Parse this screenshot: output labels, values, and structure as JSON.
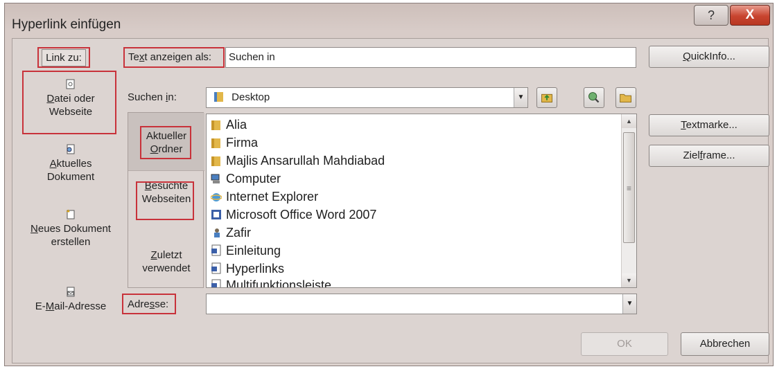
{
  "window": {
    "title": "Hyperlink einfügen",
    "help_symbol": "?",
    "close_symbol": "X"
  },
  "link_to": {
    "label": "Link zu:",
    "items": [
      {
        "label_pre": "",
        "label_u": "D",
        "label_post": "atei oder",
        "line2": "Webseite",
        "icon": "file-icon"
      },
      {
        "label_pre": "",
        "label_u": "A",
        "label_post": "ktuelles",
        "line2": "Dokument",
        "icon": "document-icon"
      },
      {
        "label_pre": "",
        "label_u": "N",
        "label_post": "eues Dokument",
        "line2": "erstellen",
        "icon": "new-document-icon"
      },
      {
        "label_pre": "E-",
        "label_u": "M",
        "label_post": "ail-Adresse",
        "line2": "",
        "icon": "email-icon"
      }
    ]
  },
  "display_text": {
    "label_pre": "Te",
    "label_u": "x",
    "label_post": "t anzeigen als:",
    "value": "Suchen in"
  },
  "quickinfo_button": {
    "label_u": "Q",
    "label_post": "uickInfo..."
  },
  "look_in": {
    "label_pre": "Suchen ",
    "label_u": "i",
    "label_post": "n:",
    "value": "Desktop"
  },
  "places": [
    {
      "line1_u": "",
      "line1": "Aktueller",
      "line2_u": "O",
      "line2": "rdner"
    },
    {
      "line1_u": "B",
      "line1": "esuchte",
      "line2_u": "",
      "line2": "Webseiten"
    },
    {
      "line1_u": "Z",
      "line1": "uletzt",
      "line2_u": "",
      "line2": "verwendet"
    }
  ],
  "files": [
    {
      "name": "Alia",
      "icon": "folder-icon"
    },
    {
      "name": "Firma",
      "icon": "folder-icon"
    },
    {
      "name": "Majlis Ansarullah Mahdiabad",
      "icon": "folder-icon"
    },
    {
      "name": "Computer",
      "icon": "computer-icon"
    },
    {
      "name": "Internet Explorer",
      "icon": "internet-explorer-icon"
    },
    {
      "name": "Microsoft Office Word 2007",
      "icon": "word-icon"
    },
    {
      "name": "Zafir",
      "icon": "user-shortcut-icon"
    },
    {
      "name": "Einleitung",
      "icon": "word-document-icon"
    },
    {
      "name": "Hyperlinks",
      "icon": "word-document-icon"
    },
    {
      "name": "Multifunktionsleiste",
      "icon": "word-document-icon"
    }
  ],
  "right_buttons": {
    "bookmark": {
      "label_u": "T",
      "label_post": "extmarke..."
    },
    "target_frame": {
      "label_pre": "Ziel",
      "label_u": "f",
      "label_post": "rame..."
    }
  },
  "address": {
    "label_pre": "Adre",
    "label_u": "s",
    "label_post": "se:",
    "value": ""
  },
  "footer": {
    "ok": "OK",
    "cancel": "Abbrechen"
  },
  "colors": {
    "highlight_box": "#c8323a",
    "close_button": "#c8442f",
    "folder": "#e2b74a"
  }
}
